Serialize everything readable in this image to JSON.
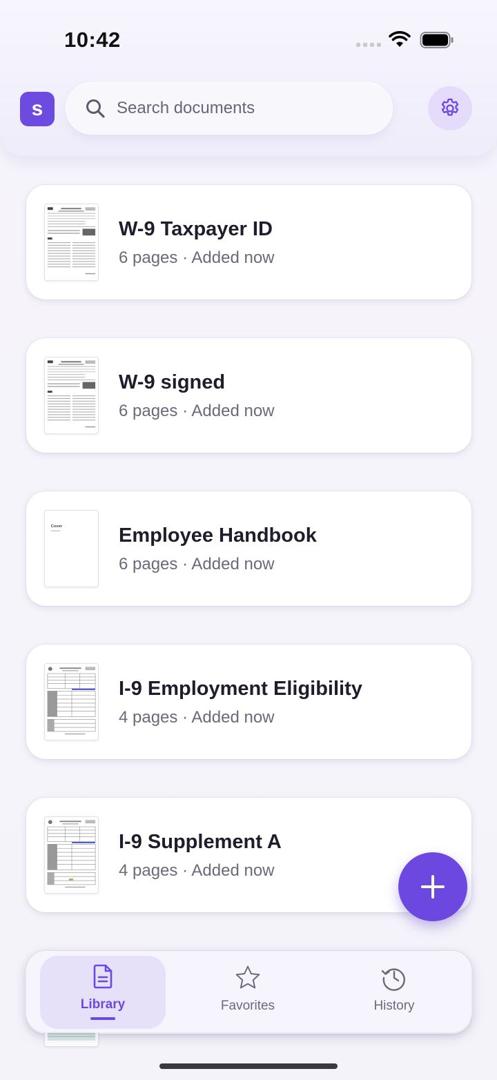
{
  "status_bar": {
    "time": "10:42"
  },
  "header": {
    "logo_letter": "s",
    "search": {
      "placeholder": "Search documents"
    }
  },
  "documents": [
    {
      "title": "W-9 Taxpayer ID",
      "meta": "6 pages · Added now",
      "thumb": "form"
    },
    {
      "title": "W-9 signed",
      "meta": "6 pages · Added now",
      "thumb": "form"
    },
    {
      "title": "Employee Handbook",
      "meta": "6 pages · Added now",
      "thumb": "cover",
      "thumb_label": "Cover"
    },
    {
      "title": "I-9 Employment Eligibility",
      "meta": "4 pages · Added now",
      "thumb": "table"
    },
    {
      "title": "I-9 Supplement A",
      "meta": "4 pages · Added now",
      "thumb": "table"
    }
  ],
  "fab": {
    "icon": "plus-icon"
  },
  "bottom_nav": {
    "items": [
      {
        "label": "Library",
        "icon": "document-icon",
        "active": true
      },
      {
        "label": "Favorites",
        "icon": "star-icon",
        "active": false
      },
      {
        "label": "History",
        "icon": "history-icon",
        "active": false
      }
    ]
  },
  "colors": {
    "accent": "#6d48e0",
    "accent_soft": "#e6e0f9",
    "muted_text": "#6b697a"
  }
}
